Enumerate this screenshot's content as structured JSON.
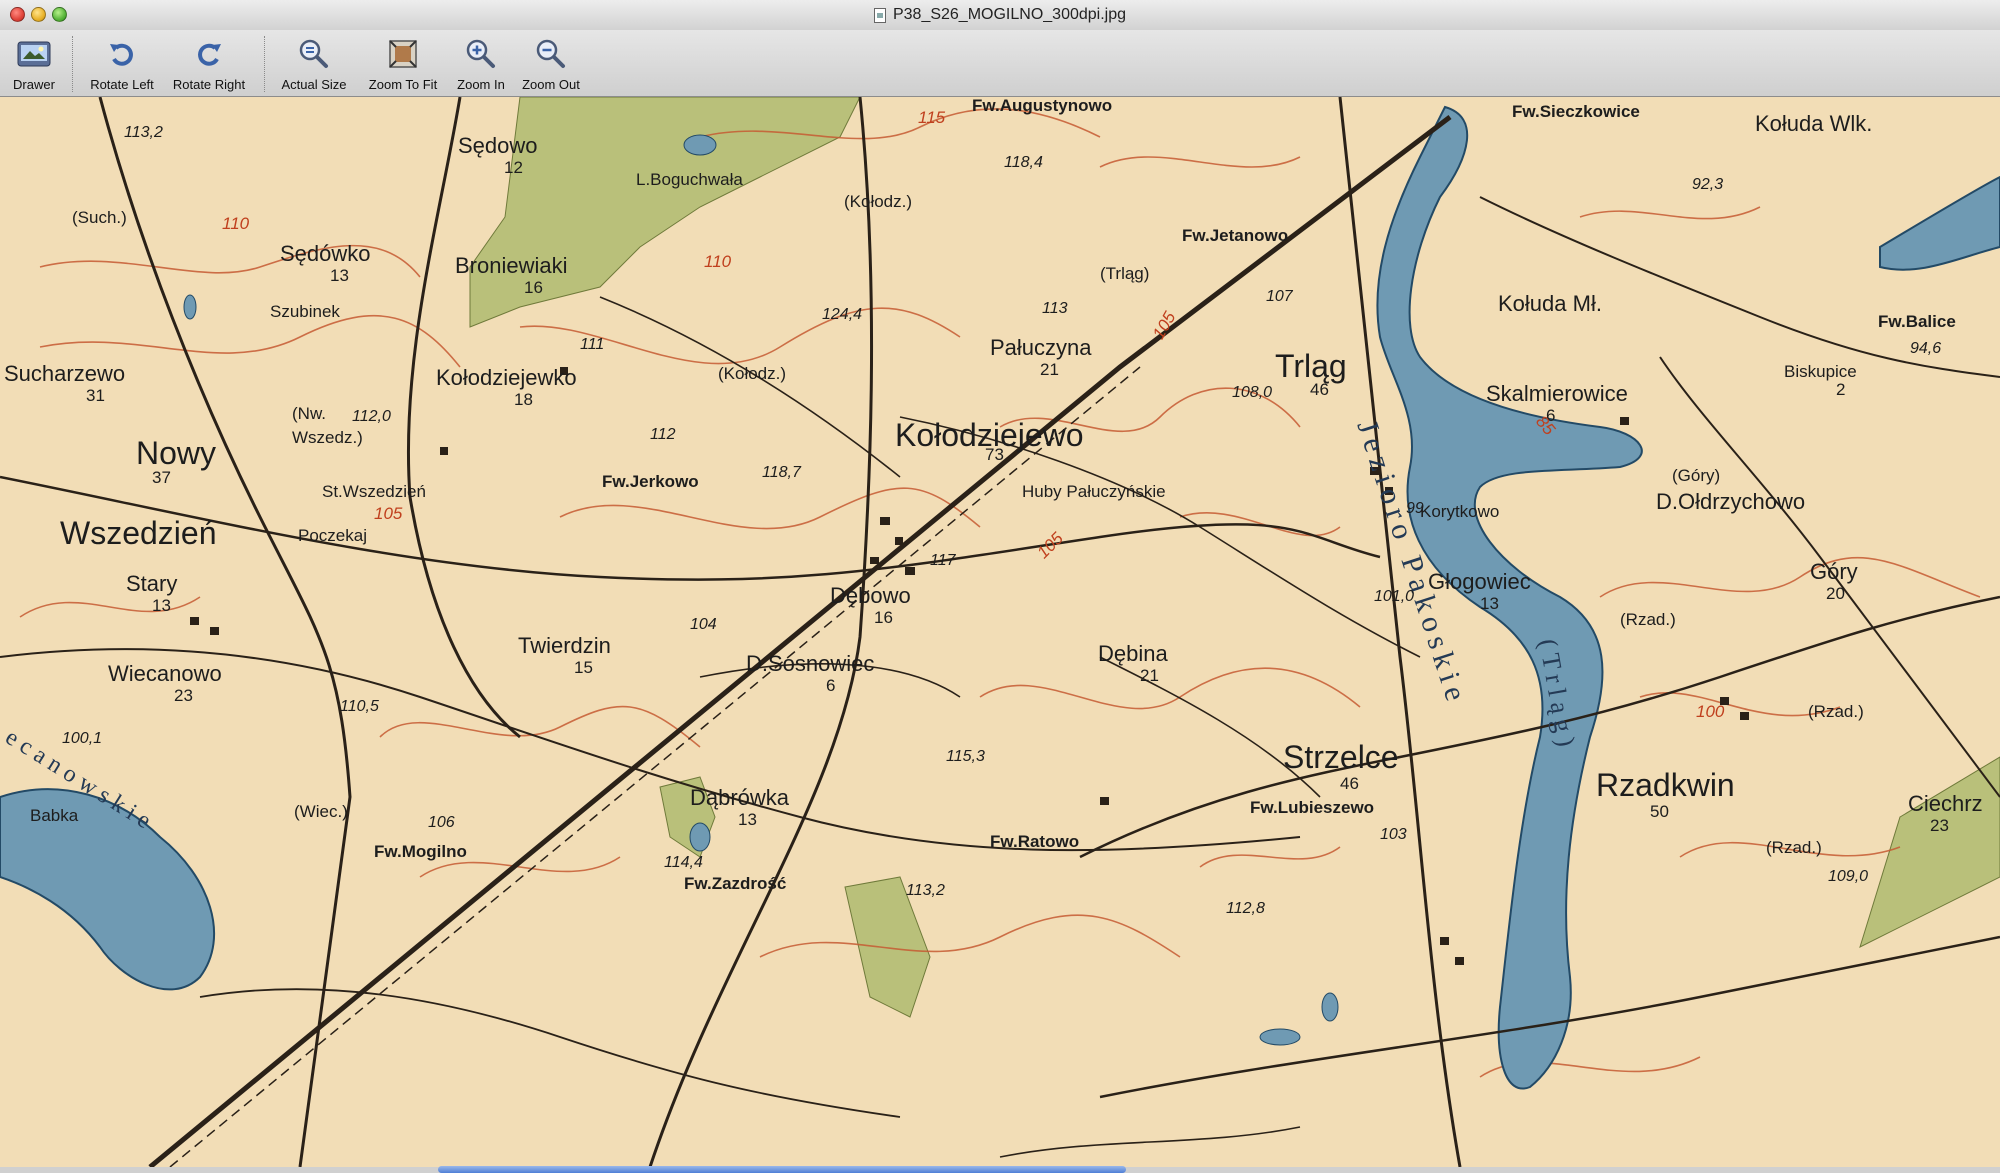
{
  "window": {
    "title": "P38_S26_MOGILNO_300dpi.jpg"
  },
  "toolbar": {
    "drawer": "Drawer",
    "rotate_left": "Rotate Left",
    "rotate_right": "Rotate Right",
    "actual_size": "Actual Size",
    "zoom_to_fit": "Zoom To Fit",
    "zoom_in": "Zoom In",
    "zoom_out": "Zoom Out"
  },
  "map": {
    "towns": {
      "kolodziejewo": "Kołodziejewo",
      "kolodziejewo_pop": "73",
      "wszedzien": "Wszedzień",
      "trlag": "Trląg",
      "trlag_pop": "46",
      "strzelce": "Strzelce",
      "strzelce_pop": "46",
      "rzadkwin": "Rzadkwin",
      "rzadkwin_pop": "50",
      "sedowo": "Sędowo",
      "sedowo_pop": "12",
      "sedowko": "Sędówko",
      "sedowko_pop": "13",
      "broniewiaki": "Broniewiaki",
      "broniewiaki_pop": "16",
      "kolodziejewko": "Kołodziejewko",
      "kolodziejewko_pop": "18",
      "sucharzewo": "Sucharzewo",
      "sucharzewo_pop": "31",
      "nowy": "Nowy",
      "nowy_pop": "37",
      "stary": "Stary",
      "stary_pop": "13",
      "wiecanowo": "Wiecanowo",
      "wiecanowo_pop": "23",
      "twierdzin": "Twierdzin",
      "twierdzin_pop": "15",
      "debowo": "Dębowo",
      "debowo_pop": "16",
      "debina": "Dębina",
      "debina_pop": "21",
      "palu": "Pałuczyna",
      "palu_pop": "21",
      "dabrowka": "Dąbrówka",
      "dabrowka_pop": "13",
      "glogowiec": "Głogowiec",
      "glogowiec_pop": "13",
      "koluda_ml": "Kołuda Mł.",
      "koluda_wlk": "Kołuda Wlk.",
      "skalmierowice": "Skalmierowice",
      "skalmierowice_pop": "6",
      "d_oldrzychowo": "D.Ołdrzychowo",
      "gory": "Góry",
      "gory_pop": "20",
      "d_sosnowiec": "D.Sosnowiec",
      "d_sosnowiec_pop": "6",
      "ciechrz": "Ciechrz",
      "ciechrz_pop": "23"
    },
    "farms": {
      "augustynowo": "Fw.Augustynowo",
      "sieczkowice": "Fw.Sieczkowice",
      "jetanowo": "Fw.Jetanowo",
      "jerkowo": "Fw.Jerkowo",
      "balice": "Fw.Balice",
      "lubieszewo": "Fw.Lubieszewo",
      "ratowo": "Fw.Ratowo",
      "mogilno": "Fw.Mogilno",
      "zazdrosc": "Fw.Zazdrość"
    },
    "misc": {
      "boguchwala": "L.Boguchwała",
      "kolodz1": "(Kołodz.)",
      "kolodz2": "(Kołodz.)",
      "trlag_paren": "(Trląg)",
      "huby": "Huby Pałuczyńskie",
      "korytkowo": "Korytkowo",
      "st_wszedzien": "St.Wszedzień",
      "poczekaj": "Poczekaj",
      "szubinek": "Szubinek",
      "such": "(Such.)",
      "nw_wszedz": "(Nw.",
      "wszedz_close": "Wszedz.)",
      "biskupice": "Biskupice",
      "biskupice_pop": "2",
      "gory_paren": "(Góry)",
      "wiec": "(Wiec.)",
      "babka": "Babka",
      "rzad1": "(Rzad.)",
      "rzad2": "(Rzad.)",
      "rzad3": "(Rzad.)"
    },
    "lakes": {
      "pakoskie": "Jezioro Pakoskie",
      "trlag_lake": "(Trląg)",
      "wiecanowskie": "ecanowskie"
    },
    "elevations": {
      "e1": "118,4",
      "e2": "124,4",
      "e3": "118,7",
      "e4": "112,0",
      "e5": "108,0",
      "e6": "101,0",
      "e7": "115,3",
      "e8": "114,4",
      "e9": "113,2",
      "e10": "92,3",
      "e11": "94,6",
      "e12": "100,1",
      "e13": "110,5",
      "e14": "112,8",
      "e15": "109,0",
      "e16": "113,2",
      "e17": "111",
      "e18": "112",
      "e19": "117",
      "e20": "107",
      "e21": "113",
      "e22": "106",
      "e23": "104",
      "e24": "103",
      "e25": "99"
    },
    "contours": {
      "c1": "115",
      "c2": "110",
      "c3": "105",
      "c4": "105",
      "c5": "100",
      "c6": "85",
      "c7": "110",
      "c8": "105"
    }
  },
  "colors": {
    "map_paper": "#f2ddb6",
    "contour": "#c65a33",
    "water": "#6f9ab3",
    "forest": "#b9c07a",
    "road": "#2a2118"
  }
}
